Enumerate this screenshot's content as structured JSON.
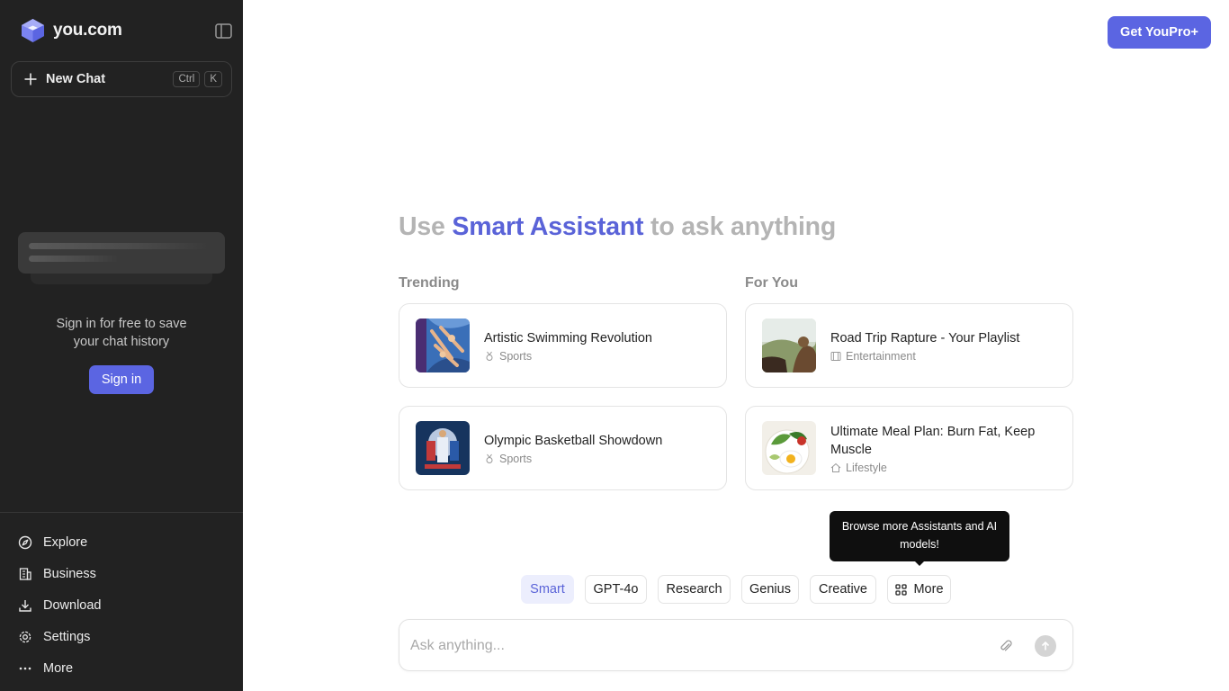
{
  "sidebar": {
    "brand": "you.com",
    "new_chat": {
      "label": "New Chat",
      "shortcut_mod": "Ctrl",
      "shortcut_key": "K"
    },
    "signin_text_line1": "Sign in for free to save",
    "signin_text_line2": "your chat history",
    "signin_button": "Sign in",
    "nav": [
      {
        "label": "Explore",
        "icon": "compass-icon"
      },
      {
        "label": "Business",
        "icon": "building-icon"
      },
      {
        "label": "Download",
        "icon": "download-icon"
      },
      {
        "label": "Settings",
        "icon": "gear-icon"
      },
      {
        "label": "More",
        "icon": "ellipsis-icon"
      }
    ]
  },
  "header": {
    "get_pro": "Get YouPro+"
  },
  "headline": {
    "pre": "Use ",
    "accent": "Smart Assistant",
    "post": " to ask anything"
  },
  "trending": {
    "title": "Trending",
    "items": [
      {
        "title": "Artistic Swimming Revolution",
        "category": "Sports",
        "category_icon": "medal-icon"
      },
      {
        "title": "Olympic Basketball Showdown",
        "category": "Sports",
        "category_icon": "medal-icon"
      }
    ]
  },
  "for_you": {
    "title": "For You",
    "items": [
      {
        "title": "Road Trip Rapture - Your Playlist",
        "category": "Entertainment",
        "category_icon": "film-icon"
      },
      {
        "title": "Ultimate Meal Plan: Burn Fat, Keep Muscle",
        "category": "Lifestyle",
        "category_icon": "home-icon"
      }
    ]
  },
  "tooltip": "Browse more Assistants and AI models!",
  "modes": [
    {
      "label": "Smart",
      "active": true
    },
    {
      "label": "GPT-4o",
      "active": false
    },
    {
      "label": "Research",
      "active": false
    },
    {
      "label": "Genius",
      "active": false
    },
    {
      "label": "Creative",
      "active": false
    },
    {
      "label": "More",
      "active": false,
      "icon": "grid-icon"
    }
  ],
  "ask": {
    "placeholder": "Ask anything...",
    "value": ""
  },
  "colors": {
    "sidebar_bg": "#222222",
    "accent": "#5b65e2",
    "accent_text": "#5a63d8"
  }
}
